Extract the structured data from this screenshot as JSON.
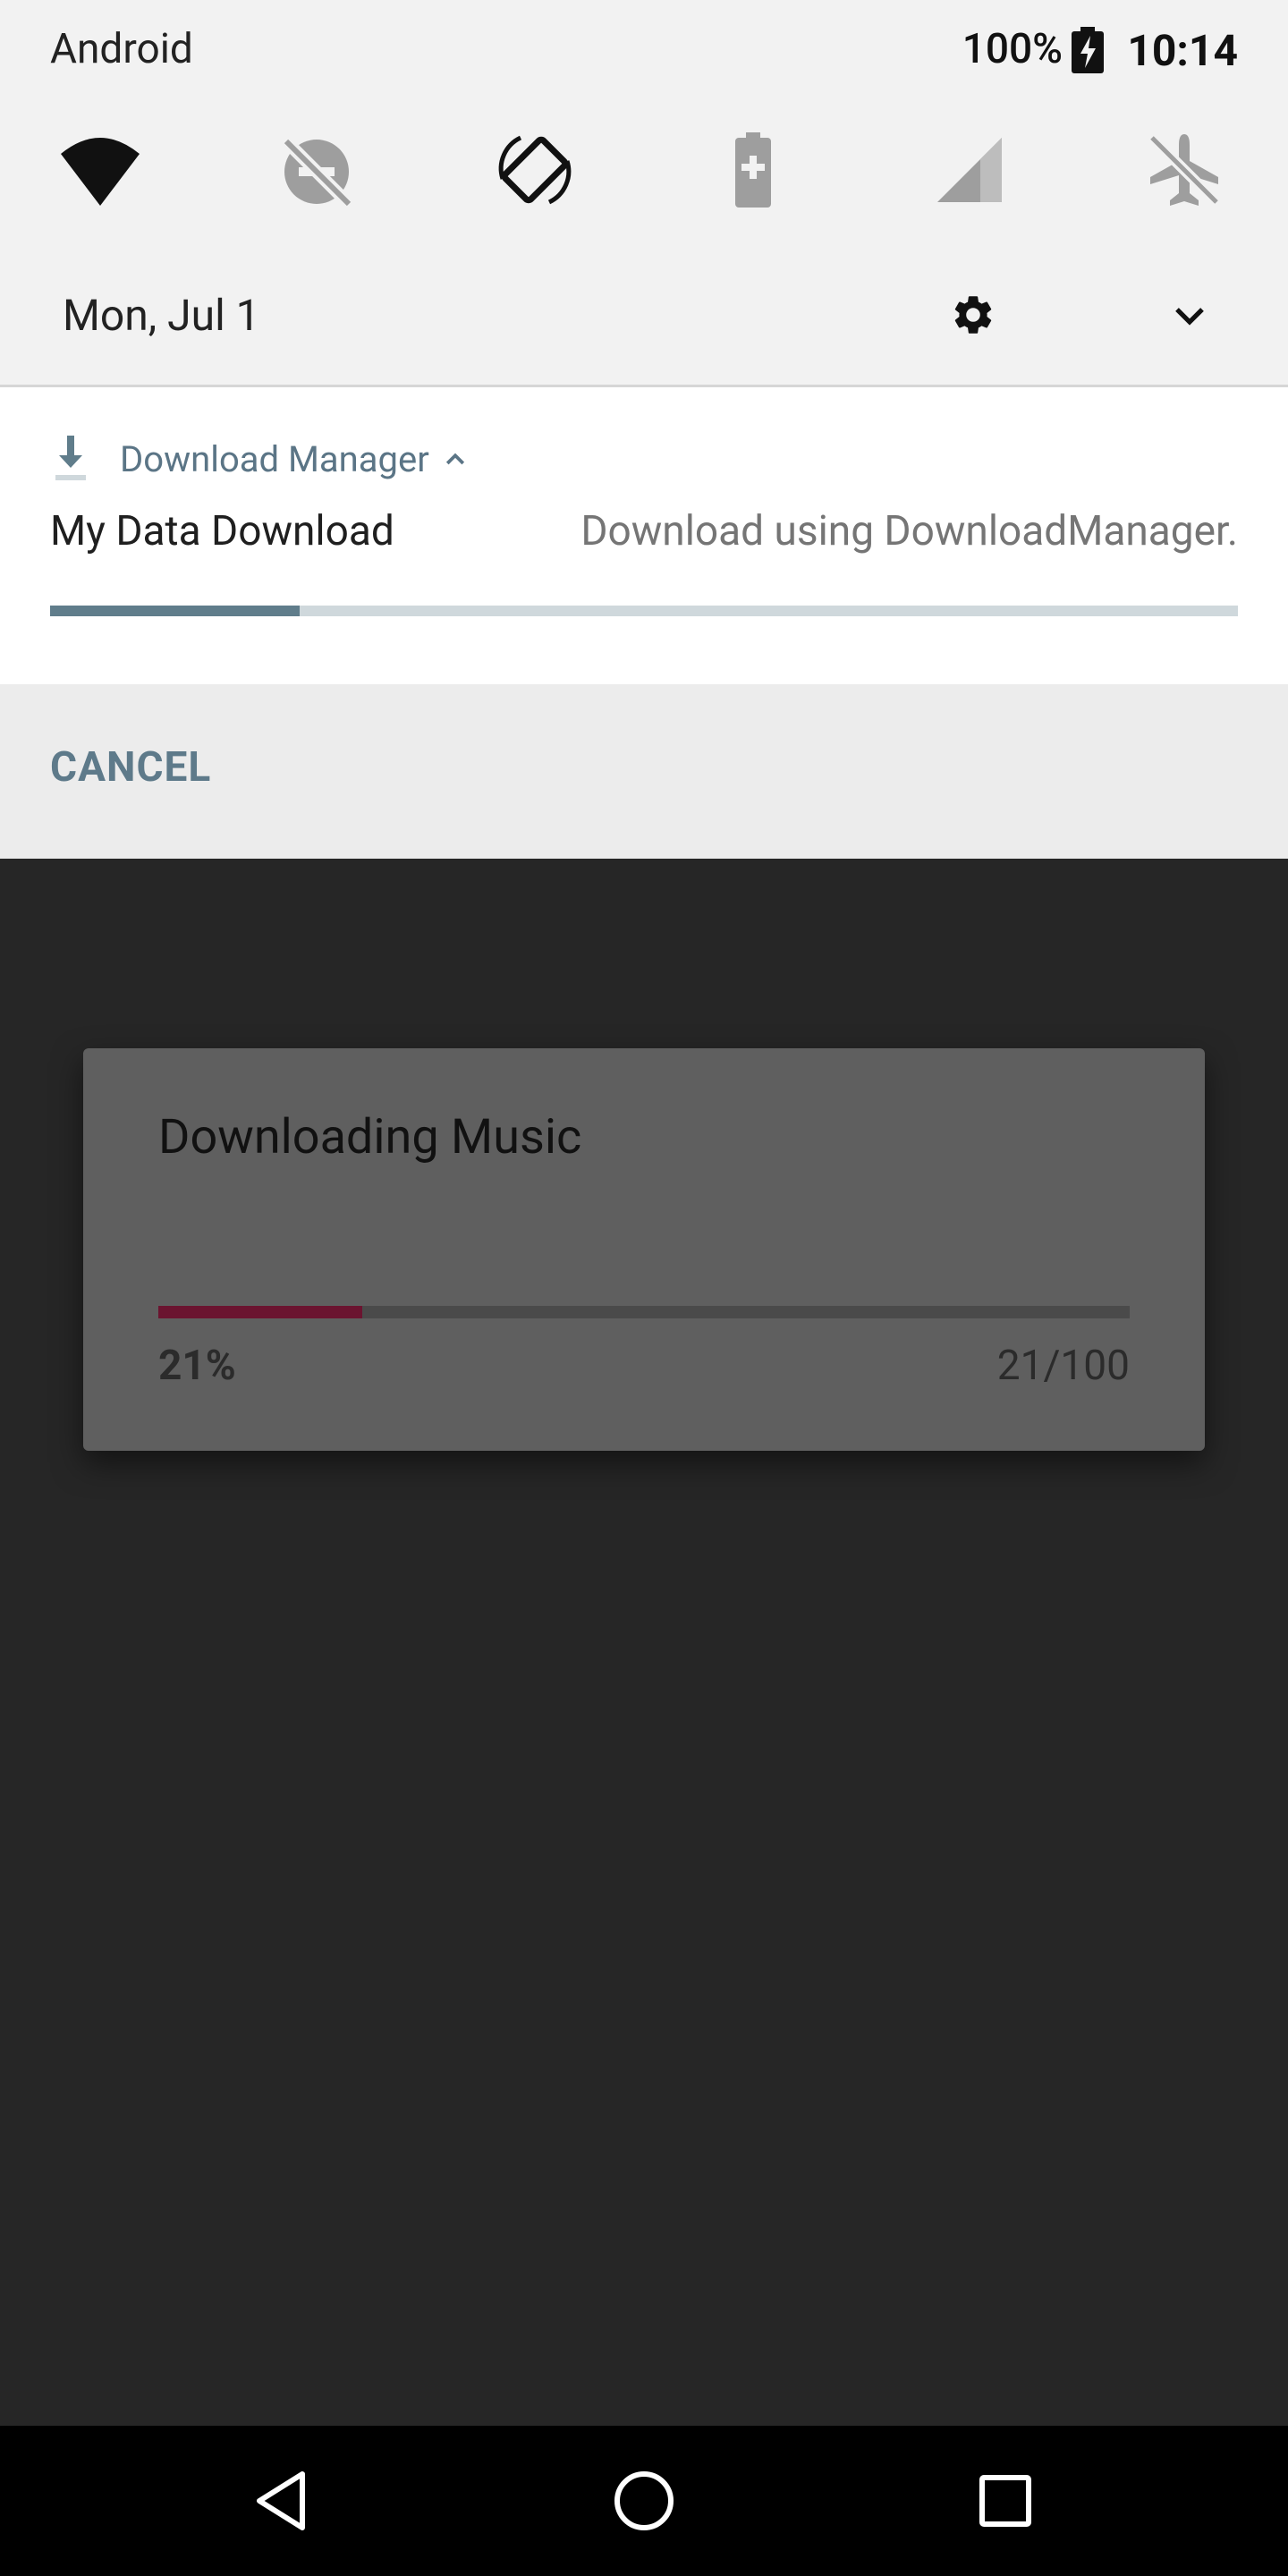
{
  "status_bar": {
    "carrier": "Android",
    "battery_percent": "100%",
    "time": "10:14",
    "battery_icon": "battery-charging-icon"
  },
  "quick_settings": {
    "tiles": [
      {
        "name": "wifi",
        "icon": "wifi-icon",
        "state": "on"
      },
      {
        "name": "do-not-disturb",
        "icon": "dnd-off-icon",
        "state": "off"
      },
      {
        "name": "auto-rotate",
        "icon": "rotate-icon",
        "state": "on"
      },
      {
        "name": "battery-saver",
        "icon": "battery-saver-icon",
        "state": "off"
      },
      {
        "name": "cellular",
        "icon": "signal-icon",
        "state": "off"
      },
      {
        "name": "airplane-mode",
        "icon": "airplane-icon",
        "state": "off"
      }
    ],
    "date": "Mon, Jul 1"
  },
  "notification": {
    "app_name": "Download Manager",
    "title": "My Data Download",
    "text": "Download using DownloadManager.",
    "progress_fraction": 0.21,
    "action_label": "CANCEL",
    "colors": {
      "accent": "#5b7586",
      "progress": "#607d8b",
      "track": "#cfd8dc"
    }
  },
  "dialog": {
    "title": "Downloading Music",
    "percent": "21%",
    "count": "21/100",
    "progress_fraction": 0.21,
    "colors": {
      "progress": "#6b1430",
      "background": "#5f5f5f"
    }
  },
  "nav_bar": {
    "buttons": [
      "back-icon",
      "home-icon",
      "recents-icon"
    ]
  }
}
